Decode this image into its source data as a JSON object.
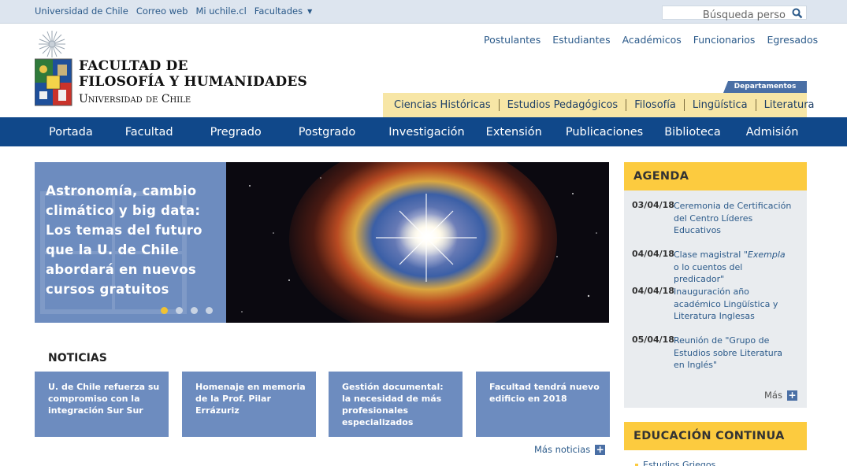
{
  "topbar": {
    "links": [
      "Universidad de Chile",
      "Correo web",
      "Mi uchile.cl",
      "Facultades"
    ],
    "search_placeholder": "Búsqueda perso"
  },
  "header": {
    "title_line1": "FACULTAD DE",
    "title_line2": "FILOSOFÍA Y HUMANIDADES",
    "subtitle": "Universidad de Chile",
    "audience_links": [
      "Postulantes",
      "Estudiantes",
      "Académicos",
      "Funcionarios",
      "Egresados"
    ],
    "departments_label": "Departamentos",
    "departments": [
      "Ciencias Históricas",
      "Estudios Pedagógicos",
      "Filosofía",
      "Lingüística",
      "Literatura"
    ]
  },
  "nav": [
    "Portada",
    "Facultad",
    "Pregrado",
    "Postgrado",
    "Investigación",
    "Extensión",
    "Publicaciones",
    "Biblioteca",
    "Admisión"
  ],
  "slider": {
    "headline": "Astronomía, cambio climático y big data: Los temas del futuro que la U. de Chile abordará en nuevos cursos gratuitos",
    "dots": 4,
    "active_dot": 0
  },
  "news": {
    "title": "NOTICIAS",
    "items": [
      "U. de Chile refuerza su compromiso con la integración Sur Sur",
      "Homenaje en memoria de la Prof. Pilar Errázuriz",
      "Gestión documental: la necesidad de más profesionales especializados",
      "Facultad tendrá nuevo edificio en 2018"
    ],
    "more": "Más noticias"
  },
  "agenda": {
    "title": "AGENDA",
    "items": [
      {
        "date": "03/04/18",
        "text": "Ceremonia de Certificación del Centro Líderes Educativos"
      },
      {
        "date": "04/04/18",
        "text_pre": "Clase magistral \"",
        "text_em": "Exempla",
        "text_post": " o lo cuentos del predicador\""
      },
      {
        "date": "04/04/18",
        "text": "Inauguración año académico Lingüística y Literatura Inglesas"
      },
      {
        "date": "05/04/18",
        "text": "Reunión de \"Grupo de Estudios sobre Literatura en Inglés\""
      }
    ],
    "more": "Más"
  },
  "education": {
    "title": "EDUCACIÓN CONTINUA",
    "items": [
      "Estudios Griegos"
    ]
  },
  "colors": {
    "nav_blue": "#10488a",
    "card_blue": "#6d8cbf",
    "accent_yellow": "#fccb3f",
    "dept_yellow": "#f7e6a6"
  }
}
